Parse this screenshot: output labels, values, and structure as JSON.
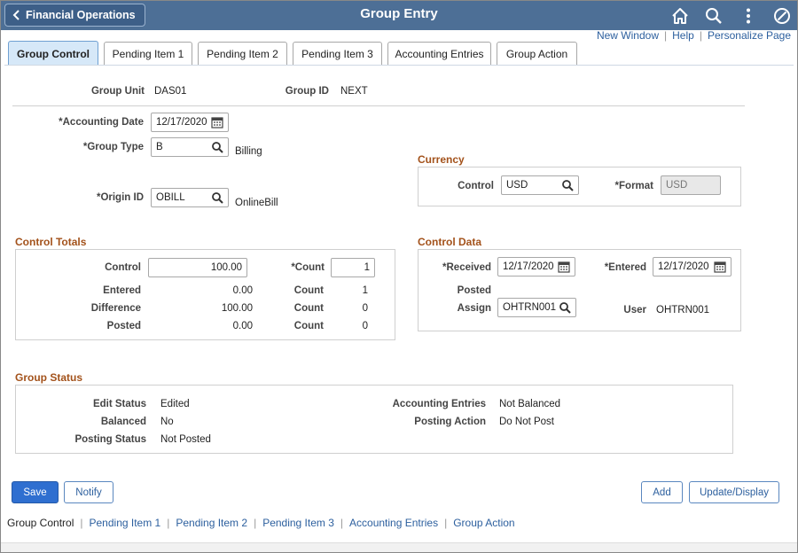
{
  "header": {
    "back_label": "Financial Operations",
    "title": "Group Entry",
    "icons": [
      "home-icon",
      "search-icon",
      "actions-menu-icon",
      "navbar-icon"
    ]
  },
  "top_links": [
    "New Window",
    "Help",
    "Personalize Page"
  ],
  "tabs": [
    "Group Control",
    "Pending Item 1",
    "Pending Item 2",
    "Pending Item 3",
    "Accounting Entries",
    "Group Action"
  ],
  "group": {
    "unit_label": "Group Unit",
    "unit_value": "DAS01",
    "id_label": "Group ID",
    "id_value": "NEXT"
  },
  "form": {
    "accounting_date_label": "*Accounting Date",
    "accounting_date": "12/17/2020",
    "group_type_label": "*Group Type",
    "group_type": "B",
    "group_type_desc": "Billing",
    "origin_id_label": "*Origin ID",
    "origin_id": "OBILL",
    "origin_desc": "OnlineBill"
  },
  "currency": {
    "title": "Currency",
    "control_label": "Control",
    "control_value": "USD",
    "format_label": "*Format",
    "format_value": "USD"
  },
  "control_totals": {
    "title": "Control Totals",
    "control_label": "Control",
    "control_value": "100.00",
    "count_label": "*Count",
    "count_value": "1",
    "rows": [
      {
        "label": "Entered",
        "amount": "0.00",
        "count_label": "Count",
        "count": "1"
      },
      {
        "label": "Difference",
        "amount": "100.00",
        "count_label": "Count",
        "count": "0"
      },
      {
        "label": "Posted",
        "amount": "0.00",
        "count_label": "Count",
        "count": "0"
      }
    ]
  },
  "control_data": {
    "title": "Control Data",
    "received_label": "*Received",
    "received": "12/17/2020",
    "entered_label": "*Entered",
    "entered": "12/17/2020",
    "posted_label": "Posted",
    "assign_label": "Assign",
    "assign": "OHTRN001",
    "user_label": "User",
    "user": "OHTRN001"
  },
  "group_status": {
    "title": "Group Status",
    "edit_status_label": "Edit Status",
    "edit_status": "Edited",
    "balanced_label": "Balanced",
    "balanced": "No",
    "posting_status_label": "Posting Status",
    "posting_status": "Not Posted",
    "accounting_entries_label": "Accounting Entries",
    "accounting_entries": "Not Balanced",
    "posting_action_label": "Posting Action",
    "posting_action": "Do Not Post"
  },
  "buttons": {
    "save": "Save",
    "notify": "Notify",
    "add": "Add",
    "update_display": "Update/Display"
  },
  "bottom_links": [
    "Group Control",
    "Pending Item 1",
    "Pending Item 2",
    "Pending Item 3",
    "Accounting Entries",
    "Group Action"
  ]
}
